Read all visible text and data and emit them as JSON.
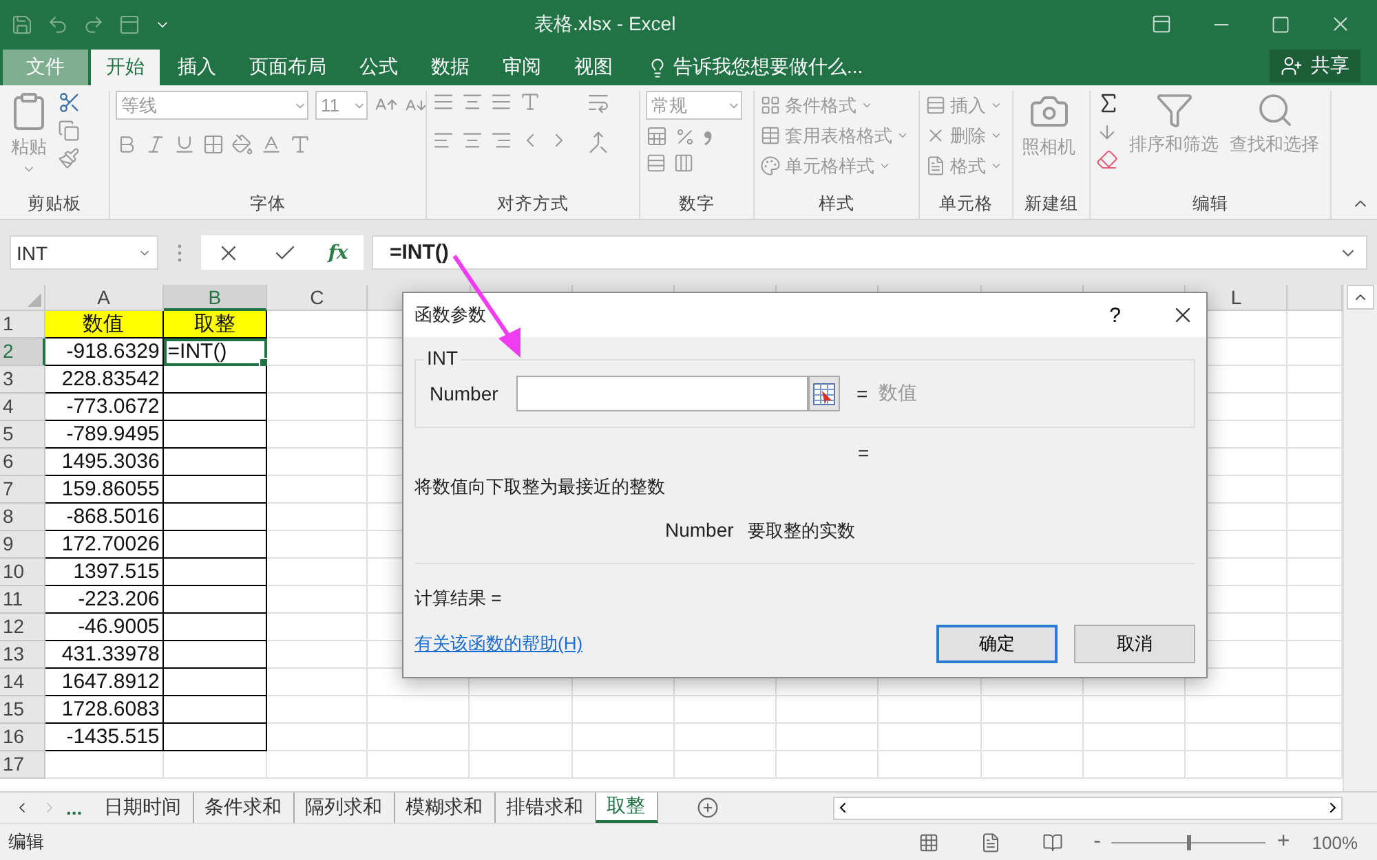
{
  "title_bar": {
    "title": "表格.xlsx - Excel"
  },
  "ribbon_tabs": [
    {
      "label": "文件",
      "kind": "file",
      "selected": false
    },
    {
      "label": "开始",
      "kind": "tab",
      "selected": true
    },
    {
      "label": "插入",
      "kind": "tab",
      "selected": false
    },
    {
      "label": "页面布局",
      "kind": "tab",
      "selected": false
    },
    {
      "label": "公式",
      "kind": "tab",
      "selected": false
    },
    {
      "label": "数据",
      "kind": "tab",
      "selected": false
    },
    {
      "label": "审阅",
      "kind": "tab",
      "selected": false
    },
    {
      "label": "视图",
      "kind": "tab",
      "selected": false
    }
  ],
  "tell_me": "告诉我您想要做什么...",
  "share": "共享",
  "ribbon": {
    "disabled": true,
    "groups": [
      {
        "kind": "clipboard",
        "label": "剪贴板",
        "paste": "粘贴"
      },
      {
        "kind": "font",
        "label": "字体",
        "font": "等线",
        "size": "11"
      },
      {
        "kind": "alignment",
        "label": "对齐方式"
      },
      {
        "kind": "number",
        "label": "数字",
        "format": "常规"
      },
      {
        "kind": "styles",
        "label": "样式",
        "items": [
          "条件格式",
          "套用表格格式",
          "单元格样式"
        ]
      },
      {
        "kind": "cells",
        "label": "单元格",
        "items": [
          "插入",
          "删除",
          "格式"
        ]
      },
      {
        "kind": "camera",
        "label": "新建组",
        "button": "照相机"
      },
      {
        "kind": "editing",
        "label": "编辑",
        "sort": "排序和筛选",
        "find": "查找和选择"
      }
    ]
  },
  "formula_bar": {
    "name_box": "INT",
    "fx": "fx",
    "formula": "=INT()"
  },
  "grid": {
    "columns": [
      {
        "label": "A",
        "selected": false
      },
      {
        "label": "B",
        "selected": true
      },
      {
        "label": "C",
        "selected": false
      }
    ],
    "right_columns": [
      {
        "label": "L",
        "selected": false
      }
    ],
    "rows": [
      {
        "header": "1",
        "selected": false,
        "cells": [
          {
            "text": "数值",
            "color": "#ffff00",
            "active": false
          },
          {
            "text": "取整",
            "color": "#ffff00",
            "active": false
          }
        ]
      },
      {
        "header": "2",
        "selected": true,
        "cells": [
          {
            "text": "-918.6329",
            "active": false
          },
          {
            "text": "=INT()",
            "active": true
          }
        ]
      },
      {
        "header": "3",
        "selected": false,
        "cells": [
          {
            "text": "228.83542",
            "active": false
          },
          {
            "active": false
          }
        ]
      },
      {
        "header": "4",
        "selected": false,
        "cells": [
          {
            "text": "-773.0672",
            "active": false
          },
          {
            "active": false
          }
        ]
      },
      {
        "header": "5",
        "selected": false,
        "cells": [
          {
            "text": "-789.9495",
            "active": false
          },
          {
            "active": false
          }
        ]
      },
      {
        "header": "6",
        "selected": false,
        "cells": [
          {
            "text": "1495.3036",
            "active": false
          },
          {
            "active": false
          }
        ]
      },
      {
        "header": "7",
        "selected": false,
        "cells": [
          {
            "text": "159.86055",
            "active": false
          },
          {
            "active": false
          }
        ]
      },
      {
        "header": "8",
        "selected": false,
        "cells": [
          {
            "text": "-868.5016",
            "active": false
          },
          {
            "active": false
          }
        ]
      },
      {
        "header": "9",
        "selected": false,
        "cells": [
          {
            "text": "172.70026",
            "active": false
          },
          {
            "active": false
          }
        ]
      },
      {
        "header": "10",
        "selected": false,
        "cells": [
          {
            "text": "1397.515",
            "active": false
          },
          {
            "active": false
          }
        ]
      },
      {
        "header": "11",
        "selected": false,
        "cells": [
          {
            "text": "-223.206",
            "active": false
          },
          {
            "active": false
          }
        ]
      },
      {
        "header": "12",
        "selected": false,
        "cells": [
          {
            "text": "-46.9005",
            "active": false
          },
          {
            "active": false
          }
        ]
      },
      {
        "header": "13",
        "selected": false,
        "cells": [
          {
            "text": "431.33978",
            "active": false
          },
          {
            "active": false
          }
        ]
      },
      {
        "header": "14",
        "selected": false,
        "cells": [
          {
            "text": "1647.8912",
            "active": false
          },
          {
            "active": false
          }
        ]
      },
      {
        "header": "15",
        "selected": false,
        "cells": [
          {
            "text": "1728.6083",
            "active": false
          },
          {
            "active": false
          }
        ]
      },
      {
        "header": "16",
        "selected": false,
        "cells": [
          {
            "text": "-1435.515",
            "active": false
          },
          {
            "active": false
          }
        ]
      },
      {
        "header": "17",
        "selected": false
      }
    ]
  },
  "dialog": {
    "title": "函数参数",
    "help": "?",
    "function": "INT",
    "arg_label": "Number",
    "arg_equals": "=",
    "arg_hint": "数值",
    "value_equals": "=",
    "description": "将数值向下取整为最接近的整数",
    "arg_name": "Number",
    "arg_description": "要取整的实数",
    "result": "计算结果 =",
    "help_link": "有关该函数的帮助(H)",
    "buttons": [
      {
        "label": "确定",
        "default": true
      },
      {
        "label": "取消",
        "default": false
      }
    ]
  },
  "sheet_tabs": {
    "more": "...",
    "tabs": [
      {
        "label": "日期时间",
        "selected": false
      },
      {
        "label": "条件求和",
        "selected": false
      },
      {
        "label": "隔列求和",
        "selected": false
      },
      {
        "label": "模糊求和",
        "selected": false
      },
      {
        "label": "排错求和",
        "selected": false
      },
      {
        "label": "取整",
        "selected": true
      }
    ]
  },
  "status_bar": {
    "mode": "编辑",
    "zoom_minus": "-",
    "zoom_plus": "+",
    "zoom": {
      "level": 0.5
    },
    "zoom_label": "100%"
  }
}
